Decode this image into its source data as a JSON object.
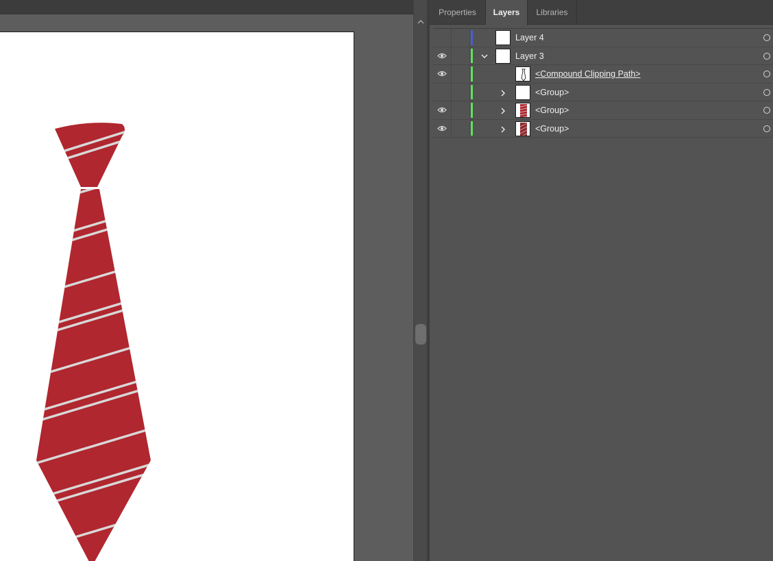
{
  "panel": {
    "tabs": [
      {
        "label": "Properties",
        "active": false
      },
      {
        "label": "Layers",
        "active": true
      },
      {
        "label": "Libraries",
        "active": false
      }
    ]
  },
  "layers": [
    {
      "name": "Layer 4",
      "visible": false,
      "color": "#4a5bd8",
      "expanded": null,
      "underlined": false,
      "thumbnail": "blank"
    },
    {
      "name": "Layer 3",
      "visible": true,
      "color": "#5ce35c",
      "expanded": true,
      "underlined": false,
      "thumbnail": "blank"
    },
    {
      "name": "<Compound Clipping Path>",
      "visible": true,
      "color": "#5ce35c",
      "expanded": null,
      "underlined": true,
      "thumbnail": "tie-outline"
    },
    {
      "name": "<Group>",
      "visible": false,
      "color": "#5ce35c",
      "expanded": false,
      "underlined": false,
      "thumbnail": "blank"
    },
    {
      "name": "<Group>",
      "visible": true,
      "color": "#5ce35c",
      "expanded": false,
      "underlined": false,
      "thumbnail": "red-stripes"
    },
    {
      "name": "<Group>",
      "visible": true,
      "color": "#5ce35c",
      "expanded": false,
      "underlined": false,
      "thumbnail": "red-stripes-diagonal"
    }
  ],
  "colors": {
    "tie_red": "#b0272f",
    "tie_stripe": "#d8d8d8"
  },
  "icons": {
    "visibility": "eye-icon",
    "expand": "chevron-right-icon",
    "collapse": "chevron-down-icon",
    "target": "target-circle-icon",
    "scroll_up": "chevron-up-icon"
  }
}
